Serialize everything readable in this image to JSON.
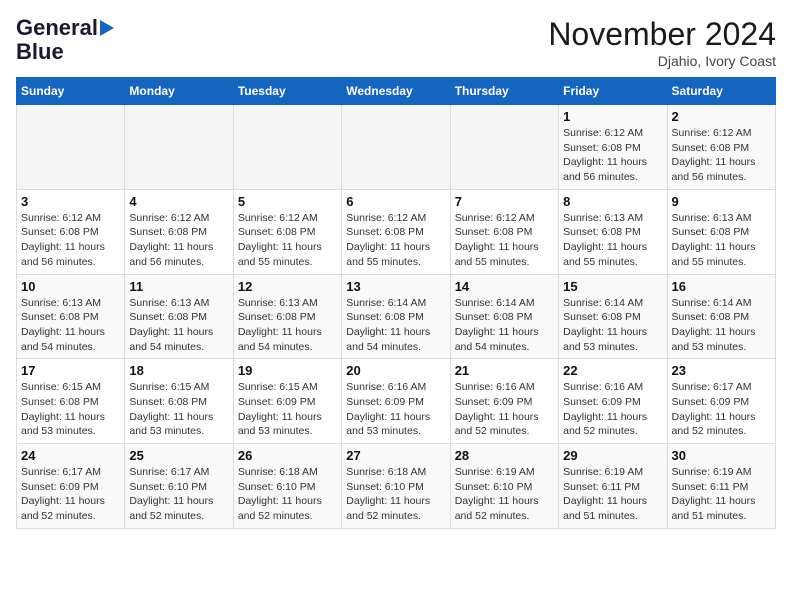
{
  "header": {
    "logo_line1": "General",
    "logo_line2": "Blue",
    "month_title": "November 2024",
    "location": "Djahio, Ivory Coast"
  },
  "weekdays": [
    "Sunday",
    "Monday",
    "Tuesday",
    "Wednesday",
    "Thursday",
    "Friday",
    "Saturday"
  ],
  "weeks": [
    [
      {
        "day": "",
        "detail": ""
      },
      {
        "day": "",
        "detail": ""
      },
      {
        "day": "",
        "detail": ""
      },
      {
        "day": "",
        "detail": ""
      },
      {
        "day": "",
        "detail": ""
      },
      {
        "day": "1",
        "detail": "Sunrise: 6:12 AM\nSunset: 6:08 PM\nDaylight: 11 hours\nand 56 minutes."
      },
      {
        "day": "2",
        "detail": "Sunrise: 6:12 AM\nSunset: 6:08 PM\nDaylight: 11 hours\nand 56 minutes."
      }
    ],
    [
      {
        "day": "3",
        "detail": "Sunrise: 6:12 AM\nSunset: 6:08 PM\nDaylight: 11 hours\nand 56 minutes."
      },
      {
        "day": "4",
        "detail": "Sunrise: 6:12 AM\nSunset: 6:08 PM\nDaylight: 11 hours\nand 56 minutes."
      },
      {
        "day": "5",
        "detail": "Sunrise: 6:12 AM\nSunset: 6:08 PM\nDaylight: 11 hours\nand 55 minutes."
      },
      {
        "day": "6",
        "detail": "Sunrise: 6:12 AM\nSunset: 6:08 PM\nDaylight: 11 hours\nand 55 minutes."
      },
      {
        "day": "7",
        "detail": "Sunrise: 6:12 AM\nSunset: 6:08 PM\nDaylight: 11 hours\nand 55 minutes."
      },
      {
        "day": "8",
        "detail": "Sunrise: 6:13 AM\nSunset: 6:08 PM\nDaylight: 11 hours\nand 55 minutes."
      },
      {
        "day": "9",
        "detail": "Sunrise: 6:13 AM\nSunset: 6:08 PM\nDaylight: 11 hours\nand 55 minutes."
      }
    ],
    [
      {
        "day": "10",
        "detail": "Sunrise: 6:13 AM\nSunset: 6:08 PM\nDaylight: 11 hours\nand 54 minutes."
      },
      {
        "day": "11",
        "detail": "Sunrise: 6:13 AM\nSunset: 6:08 PM\nDaylight: 11 hours\nand 54 minutes."
      },
      {
        "day": "12",
        "detail": "Sunrise: 6:13 AM\nSunset: 6:08 PM\nDaylight: 11 hours\nand 54 minutes."
      },
      {
        "day": "13",
        "detail": "Sunrise: 6:14 AM\nSunset: 6:08 PM\nDaylight: 11 hours\nand 54 minutes."
      },
      {
        "day": "14",
        "detail": "Sunrise: 6:14 AM\nSunset: 6:08 PM\nDaylight: 11 hours\nand 54 minutes."
      },
      {
        "day": "15",
        "detail": "Sunrise: 6:14 AM\nSunset: 6:08 PM\nDaylight: 11 hours\nand 53 minutes."
      },
      {
        "day": "16",
        "detail": "Sunrise: 6:14 AM\nSunset: 6:08 PM\nDaylight: 11 hours\nand 53 minutes."
      }
    ],
    [
      {
        "day": "17",
        "detail": "Sunrise: 6:15 AM\nSunset: 6:08 PM\nDaylight: 11 hours\nand 53 minutes."
      },
      {
        "day": "18",
        "detail": "Sunrise: 6:15 AM\nSunset: 6:08 PM\nDaylight: 11 hours\nand 53 minutes."
      },
      {
        "day": "19",
        "detail": "Sunrise: 6:15 AM\nSunset: 6:09 PM\nDaylight: 11 hours\nand 53 minutes."
      },
      {
        "day": "20",
        "detail": "Sunrise: 6:16 AM\nSunset: 6:09 PM\nDaylight: 11 hours\nand 53 minutes."
      },
      {
        "day": "21",
        "detail": "Sunrise: 6:16 AM\nSunset: 6:09 PM\nDaylight: 11 hours\nand 52 minutes."
      },
      {
        "day": "22",
        "detail": "Sunrise: 6:16 AM\nSunset: 6:09 PM\nDaylight: 11 hours\nand 52 minutes."
      },
      {
        "day": "23",
        "detail": "Sunrise: 6:17 AM\nSunset: 6:09 PM\nDaylight: 11 hours\nand 52 minutes."
      }
    ],
    [
      {
        "day": "24",
        "detail": "Sunrise: 6:17 AM\nSunset: 6:09 PM\nDaylight: 11 hours\nand 52 minutes."
      },
      {
        "day": "25",
        "detail": "Sunrise: 6:17 AM\nSunset: 6:10 PM\nDaylight: 11 hours\nand 52 minutes."
      },
      {
        "day": "26",
        "detail": "Sunrise: 6:18 AM\nSunset: 6:10 PM\nDaylight: 11 hours\nand 52 minutes."
      },
      {
        "day": "27",
        "detail": "Sunrise: 6:18 AM\nSunset: 6:10 PM\nDaylight: 11 hours\nand 52 minutes."
      },
      {
        "day": "28",
        "detail": "Sunrise: 6:19 AM\nSunset: 6:10 PM\nDaylight: 11 hours\nand 52 minutes."
      },
      {
        "day": "29",
        "detail": "Sunrise: 6:19 AM\nSunset: 6:11 PM\nDaylight: 11 hours\nand 51 minutes."
      },
      {
        "day": "30",
        "detail": "Sunrise: 6:19 AM\nSunset: 6:11 PM\nDaylight: 11 hours\nand 51 minutes."
      }
    ]
  ]
}
